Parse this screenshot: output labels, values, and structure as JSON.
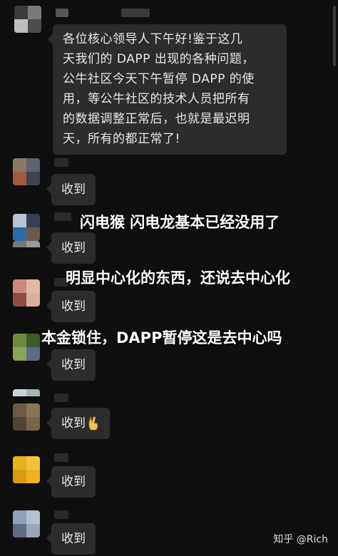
{
  "messages": [
    {
      "text": "各位核心领导人下午好!鉴于这几天我们的 DAPP 出现的各种问题，公牛社区今天下午暂停 DAPP 的使用，等公牛社区的技术人员把所有的数据调整正常后，也就是最迟明天，所有的都正常了!"
    },
    {
      "text": "收到"
    },
    {
      "text": "收到"
    },
    {
      "text": "收到"
    },
    {
      "text": "收到"
    },
    {
      "text": "收到",
      "emoji": "victory-hand"
    },
    {
      "text": "收到"
    },
    {
      "text": "收到"
    }
  ],
  "big_message_lines": [
    "各位核心领导人下午好!鉴于这几",
    "天我们的 DAPP 出现的各种问题，",
    "公牛社区今天下午暂停 DAPP 的使",
    "用，等公牛社区的技术人员把所有",
    "的数据调整正常后，也就是最迟明",
    "天，所有的都正常了!"
  ],
  "overlay_captions": [
    "闪电猴 闪电龙基本已经没用了",
    "明显中心化的东西，还说去中心化",
    "本金锁住，DAPP暂停这是去中心吗"
  ],
  "watermark": "知乎 @Rich",
  "colors": {
    "background": "#0f0f0f",
    "bubble": "#2c2c2c",
    "text": "#e8e8e8"
  }
}
